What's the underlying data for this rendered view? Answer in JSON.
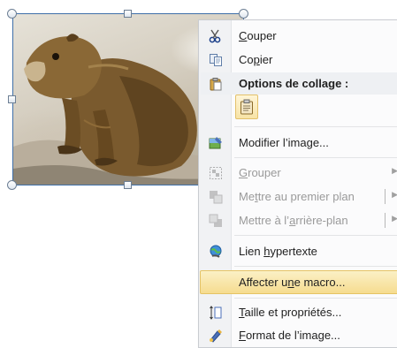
{
  "picture": {
    "alt": "photo of a marmot sitting on rocks"
  },
  "menu": {
    "cut": {
      "pre": "",
      "key": "C",
      "post": "ouper",
      "icon": "scissors-icon"
    },
    "copy": {
      "pre": "Co",
      "key": "p",
      "post": "ier",
      "icon": "copy-icon"
    },
    "paste_header": "Options de collage :",
    "edit_image": {
      "pre": "Modifier l’ima",
      "key": "g",
      "post": "e...",
      "icon": "edit-image-icon"
    },
    "group": {
      "pre": "",
      "key": "G",
      "post": "rouper",
      "icon": "group-icon"
    },
    "bring_front": {
      "pre": "Me",
      "key": "t",
      "post": "tre au premier plan",
      "icon": "bring-to-front-icon"
    },
    "send_back": {
      "pre": "Mettre à l’",
      "key": "a",
      "post": "rrière-plan",
      "icon": "send-to-back-icon"
    },
    "hyperlink": {
      "pre": "Lien ",
      "key": "h",
      "post": "ypertexte",
      "icon": "hyperlink-icon"
    },
    "macro": {
      "pre": "Affecter u",
      "key": "n",
      "post": "e macro...",
      "icon": ""
    },
    "size": {
      "pre": "",
      "key": "T",
      "post": "aille et propriétés...",
      "icon": "size-properties-icon"
    },
    "format": {
      "pre": "",
      "key": "F",
      "post": "ormat de l’image...",
      "icon": "format-image-icon"
    }
  }
}
